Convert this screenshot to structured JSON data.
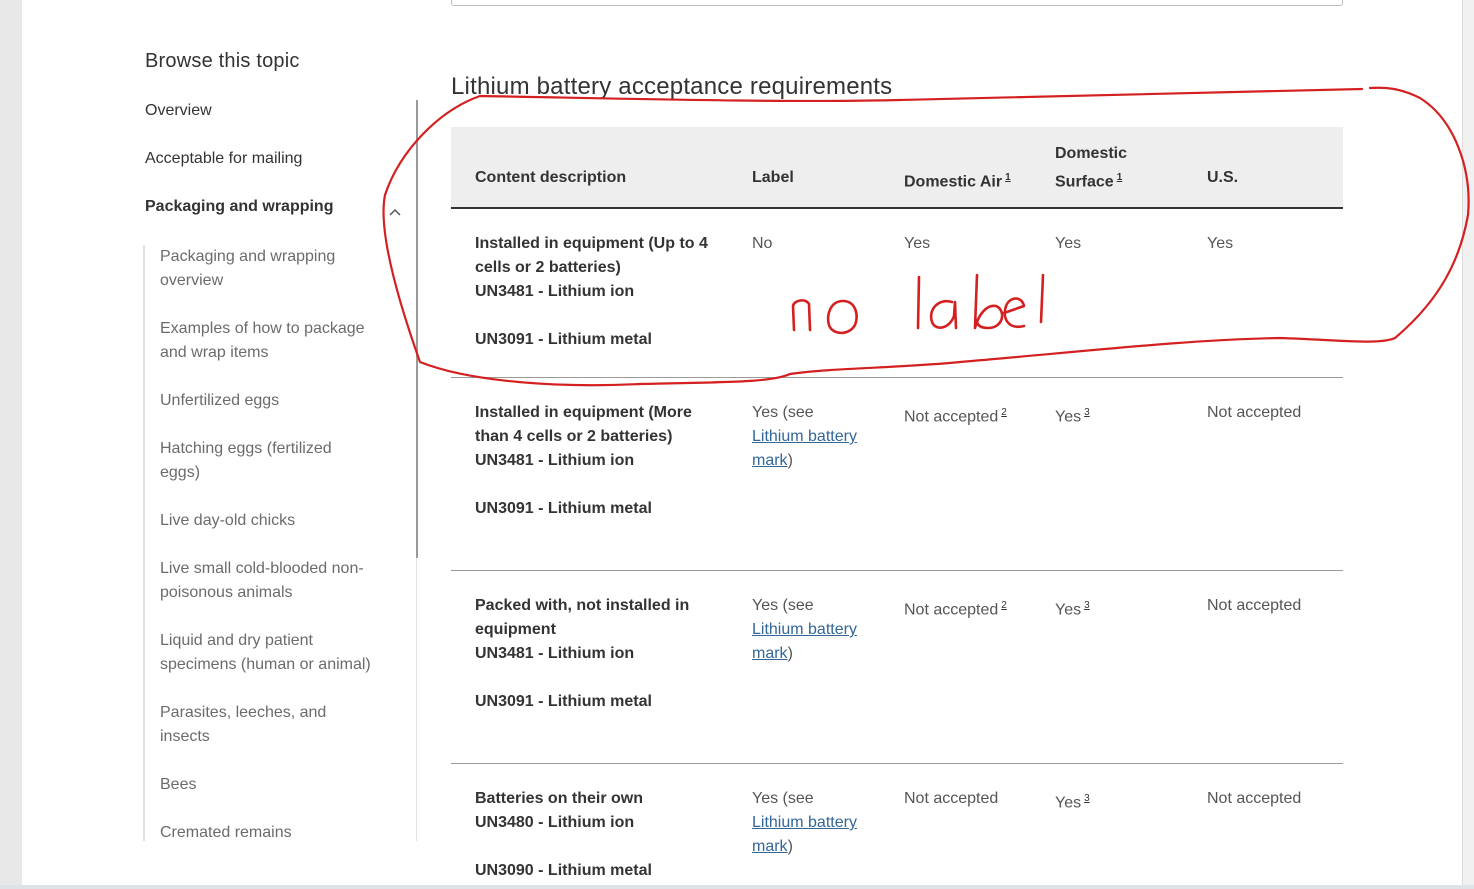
{
  "sidebar": {
    "title": "Browse this topic",
    "items": [
      {
        "label": "Overview"
      },
      {
        "label": "Acceptable for mailing"
      },
      {
        "label": "Packaging and wrapping",
        "expanded": true
      }
    ],
    "subitems": [
      {
        "label": "Packaging and wrapping overview"
      },
      {
        "label": "Examples of how to package and wrap items"
      },
      {
        "label": "Unfertilized eggs"
      },
      {
        "label": "Hatching eggs (fertilized eggs)"
      },
      {
        "label": "Live day-old chicks"
      },
      {
        "label": "Live small cold-blooded non-poisonous animals"
      },
      {
        "label": "Liquid and dry patient specimens (human or animal)"
      },
      {
        "label": "Parasites, leeches, and insects"
      },
      {
        "label": "Bees"
      },
      {
        "label": "Cremated remains"
      }
    ]
  },
  "main": {
    "section_title": "Lithium battery acceptance requirements",
    "table": {
      "headers": {
        "content": "Content description",
        "label": "Label",
        "domestic_air": "Domestic Air",
        "domestic_air_note": "1",
        "domestic_surface_l1": "Domestic",
        "domestic_surface_l2": "Surface",
        "domestic_surface_note": "1",
        "us": "U.S."
      },
      "rows": [
        {
          "desc_l1": "Installed in equipment (Up to 4",
          "desc_l2": "cells or 2 batteries)",
          "desc_l3": "UN3481 - Lithium ion",
          "desc_l4": "UN3091 - Lithium metal",
          "label": "No",
          "air": "Yes",
          "surface": "Yes",
          "us": "Yes"
        },
        {
          "desc_l1": "Installed in equipment (More",
          "desc_l2": "than 4 cells or 2 batteries)",
          "desc_l3": "UN3481 - Lithium ion",
          "desc_l4": "UN3091 - Lithium metal",
          "label_prefix": "Yes (see",
          "label_link_l1": "Lithium battery",
          "label_link_l2": "mark",
          "label_suffix": ")",
          "air": "Not accepted",
          "air_note": "2",
          "surface": "Yes",
          "surface_note": "3",
          "us": "Not accepted"
        },
        {
          "desc_l1": "Packed with, not installed in",
          "desc_l2": "equipment",
          "desc_l3": "UN3481 - Lithium ion",
          "desc_l4": "UN3091 - Lithium metal",
          "label_prefix": "Yes (see",
          "label_link_l1": "Lithium battery",
          "label_link_l2": "mark",
          "label_suffix": ")",
          "air": "Not accepted",
          "air_note": "2",
          "surface": "Yes",
          "surface_note": "3",
          "us": "Not accepted"
        },
        {
          "desc_l1": "Batteries on their own",
          "desc_l2": "UN3480 - Lithium ion",
          "desc_l4": "UN3090 - Lithium metal",
          "label_prefix": "Yes (see",
          "label_link_l1": "Lithium battery",
          "label_link_l2": "mark",
          "label_suffix": ")",
          "air": "Not accepted",
          "surface": "Yes",
          "surface_note": "3",
          "us": "Not accepted"
        }
      ]
    }
  },
  "annotation": {
    "text": "no label",
    "color": "#d42020"
  }
}
